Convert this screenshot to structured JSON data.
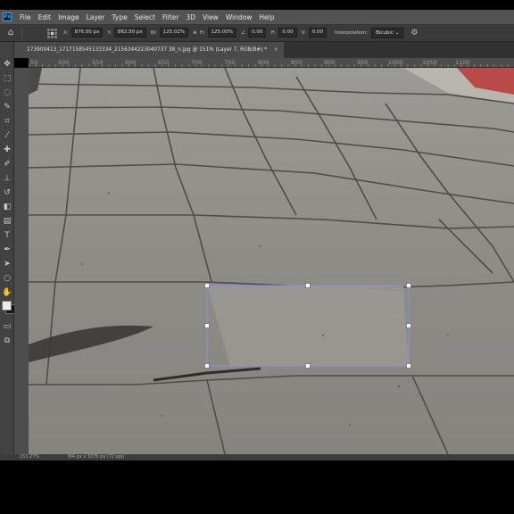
{
  "menubar": {
    "logo": "Ps",
    "items": [
      "File",
      "Edit",
      "Image",
      "Layer",
      "Type",
      "Select",
      "Filter",
      "3D",
      "View",
      "Window",
      "Help"
    ]
  },
  "options": {
    "x_label": "X:",
    "x_value": "876.00 px",
    "y_label": "Y:",
    "y_value": "882.50 px",
    "w_label": "W:",
    "w_value": "125.02%",
    "h_label": "H:",
    "h_value": "125.00%",
    "angle_value": "0.00",
    "hskew_label": "H:",
    "hskew_value": "0.00",
    "vskew_label": "V:",
    "vskew_value": "0.00",
    "interpolation_label": "Interpolation:",
    "interpolation_value": "Bicubic"
  },
  "document": {
    "tab_title": "173900413_1717158545133334_2156344223040737 38_n.jpg @ 151% (Layer 7, RGB/8#) *",
    "close": "×"
  },
  "ruler": {
    "labels": [
      "50",
      "500",
      "550",
      "600",
      "650",
      "700",
      "750",
      "800",
      "850",
      "900",
      "950",
      "1000",
      "1050",
      "1100"
    ]
  },
  "status": {
    "zoom": "151.27%",
    "doc": "W4 px x 1079 px (72 ppi)"
  },
  "tools": [
    "move-icon",
    "marquee-icon",
    "lasso-icon",
    "quick-select-icon",
    "crop-icon",
    "eyedropper-icon",
    "healing-icon",
    "brush-icon",
    "stamp-icon",
    "history-brush-icon",
    "eraser-icon",
    "gradient-icon",
    "blur-icon",
    "dodge-icon",
    "pen-icon",
    "type-icon",
    "path-select-icon",
    "shape-icon",
    "hand-icon",
    "zoom-icon",
    "more-icon"
  ],
  "colors": {
    "menubar_bg": "#535353",
    "optbar_bg": "#3a3a3a",
    "toolbar_bg": "#424242",
    "canvas_pavement": "#8c8a86",
    "transform_box": "#8a8fd0",
    "red_curb": "#b84a4a"
  }
}
